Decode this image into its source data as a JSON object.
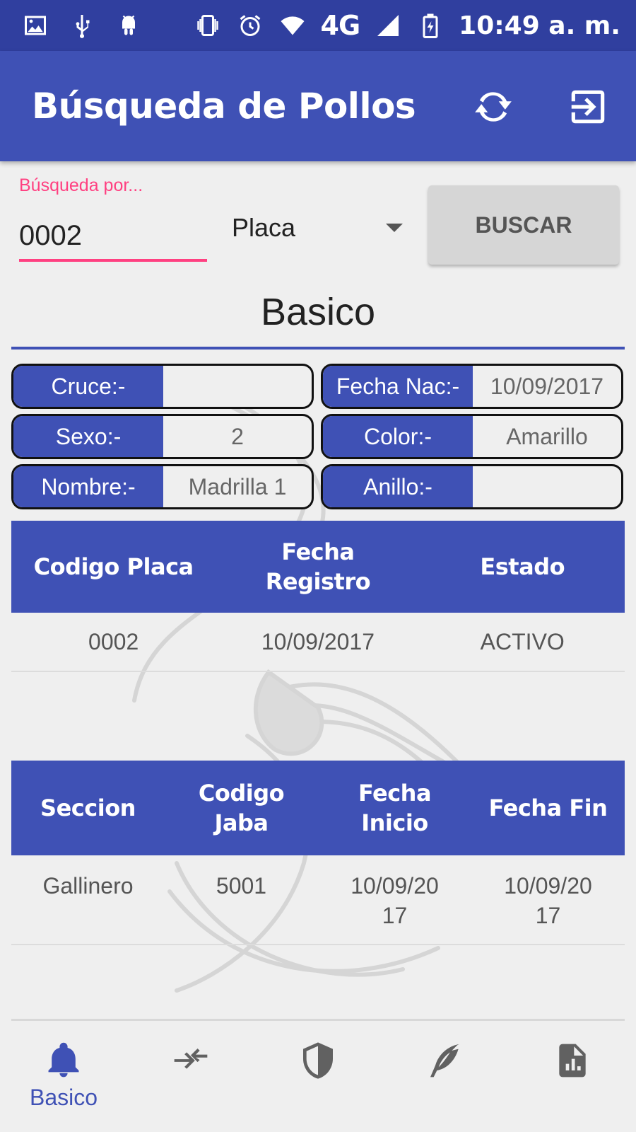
{
  "status_bar": {
    "network": "4G",
    "time": "10:49 a. m.",
    "icons": [
      "image-icon",
      "usb-icon",
      "android-icon",
      "vibrate-icon",
      "alarm-icon",
      "wifi-icon",
      "signal-icon",
      "battery-icon"
    ]
  },
  "app_bar": {
    "title": "Búsqueda de Pollos",
    "actions": [
      "refresh-icon",
      "exit-icon"
    ],
    "color": "#3f51b5"
  },
  "search": {
    "label": "Búsqueda por...",
    "value": "0002",
    "type_selected": "Placa",
    "button_label": "BUSCAR",
    "accent": "#ff4081"
  },
  "section": {
    "title": "Basico"
  },
  "info": {
    "cruce": {
      "label": "Cruce:-",
      "value": ""
    },
    "fecha_nac": {
      "label": "Fecha Nac:-",
      "value": "10/09/2017"
    },
    "sexo": {
      "label": "Sexo:-",
      "value": "2"
    },
    "color": {
      "label": "Color:-",
      "value": "Amarillo"
    },
    "nombre": {
      "label": "Nombre:-",
      "value": "Madrilla 1"
    },
    "anillo": {
      "label": "Anillo:-",
      "value": ""
    }
  },
  "placas_table": {
    "headers": [
      "Codigo Placa",
      "Fecha\nRegistro",
      "Estado"
    ],
    "rows": [
      [
        "0002",
        "10/09/2017",
        "ACTIVO"
      ]
    ]
  },
  "jabas_table": {
    "headers": [
      "Seccion",
      "Codigo\nJaba",
      "Fecha\nInicio",
      "Fecha Fin"
    ],
    "rows": [
      [
        "Gallinero",
        "5001",
        "10/09/20\n17",
        "10/09/20\n17"
      ]
    ]
  },
  "bottom_nav": {
    "items": [
      {
        "icon": "bell-icon",
        "label": "Basico",
        "active": true
      },
      {
        "icon": "swap-icon",
        "label": ""
      },
      {
        "icon": "shield-icon",
        "label": ""
      },
      {
        "icon": "feather-icon",
        "label": ""
      },
      {
        "icon": "report-icon",
        "label": ""
      }
    ],
    "active_color": "#3f51b5",
    "inactive_color": "#616161"
  }
}
